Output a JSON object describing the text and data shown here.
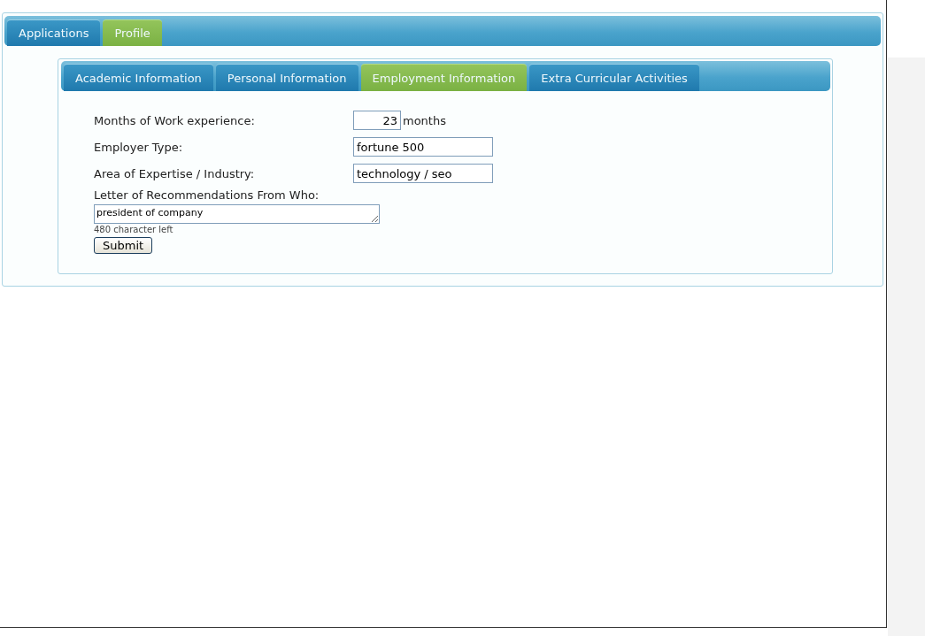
{
  "main_tabs": [
    {
      "label": "Applications",
      "selected": false
    },
    {
      "label": "Profile",
      "selected": true
    }
  ],
  "section_tabs": [
    {
      "label": "Academic Information",
      "selected": false
    },
    {
      "label": "Personal Information",
      "selected": false
    },
    {
      "label": "Employment Information",
      "selected": true
    },
    {
      "label": "Extra Curricular Activities",
      "selected": false
    }
  ],
  "fields": [
    {
      "kind": "number",
      "label": "Months of Work experience:",
      "value": "23",
      "suffix": "months"
    },
    {
      "kind": "text",
      "label": "Employer Type:",
      "value": "fortune 500"
    },
    {
      "kind": "text",
      "label": "Area of Expertise / Industry:",
      "value": "technology / seo"
    },
    {
      "kind": "textarea",
      "label": "Letter of Recommendations From Who:",
      "value": "president of company",
      "hint": "480 character left"
    }
  ],
  "submit": "Submit"
}
